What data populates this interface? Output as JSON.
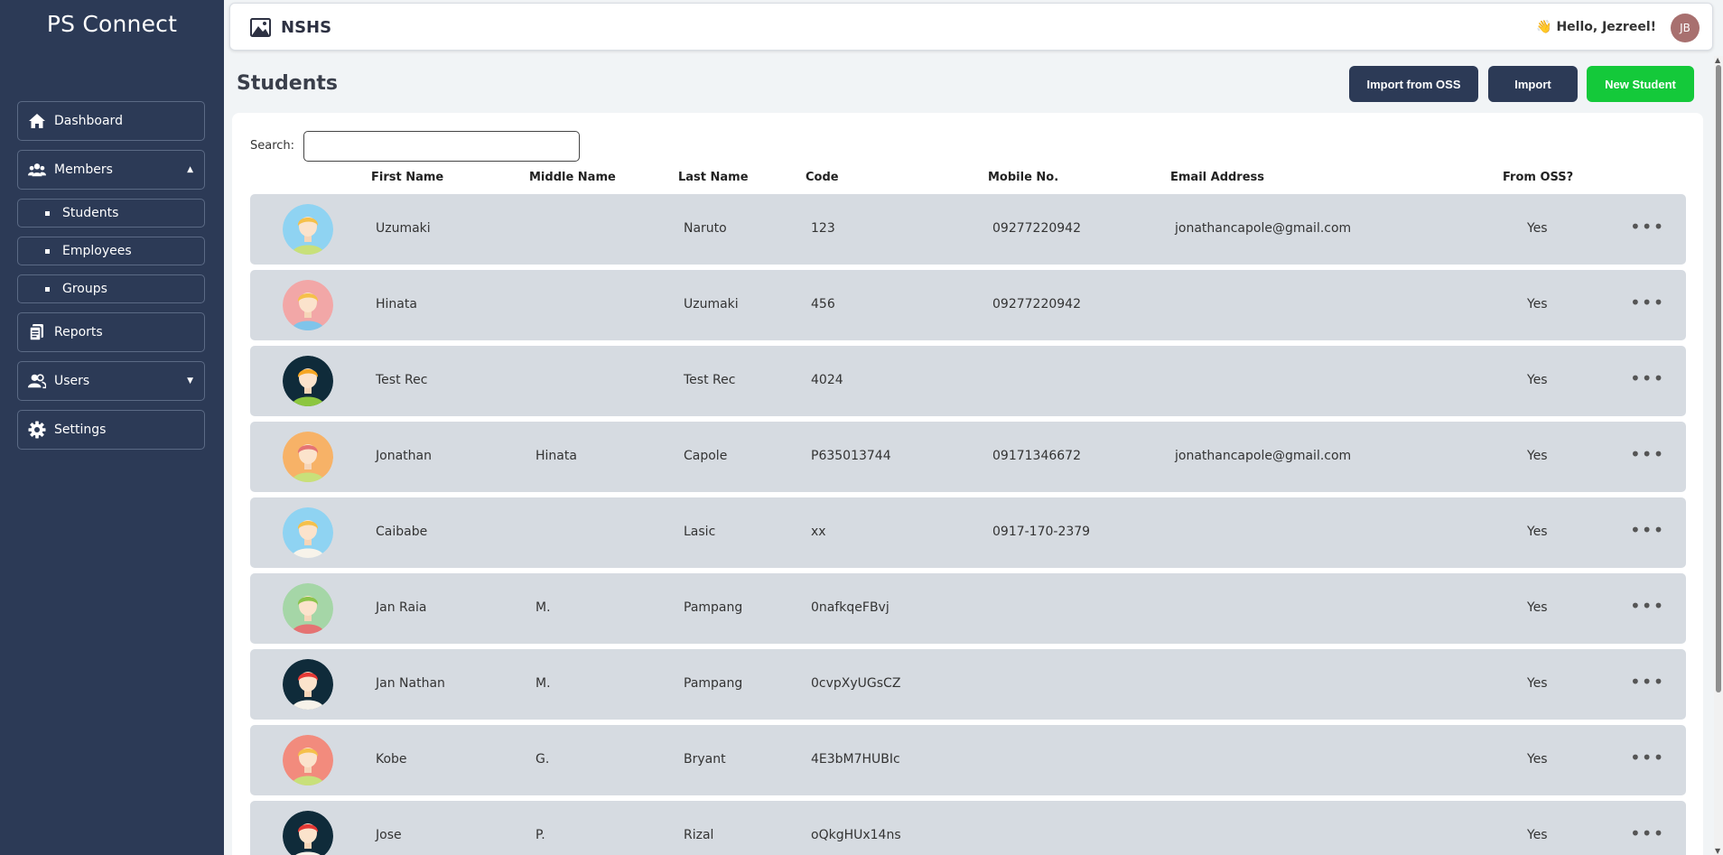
{
  "sidebar": {
    "brand": "PS Connect",
    "items": [
      {
        "label": "Dashboard"
      },
      {
        "label": "Members"
      },
      {
        "label": "Students"
      },
      {
        "label": "Employees"
      },
      {
        "label": "Groups"
      },
      {
        "label": "Reports"
      },
      {
        "label": "Users"
      },
      {
        "label": "Settings"
      }
    ]
  },
  "topbar": {
    "title": "NSHS",
    "greeting": "👋 Hello, Jezreel!",
    "avatar_initials": "JB"
  },
  "page": {
    "title": "Students",
    "buttons": {
      "import_oss": "Import from OSS",
      "import": "Import",
      "new_student": "New Student"
    }
  },
  "search": {
    "label": "Search:",
    "value": "",
    "placeholder": ""
  },
  "table": {
    "headers": {
      "first_name": "First Name",
      "middle_name": "Middle Name",
      "last_name": "Last Name",
      "code": "Code",
      "mobile": "Mobile No.",
      "email": "Email Address",
      "from_oss": "From OSS?"
    },
    "rows": [
      {
        "first": "Uzumaki",
        "middle": "",
        "last": "Naruto",
        "code": "123",
        "mobile": "09277220942",
        "email": "jonathancapole@gmail.com",
        "oss": "Yes",
        "avatar_bg": "#8fd3f2",
        "hair": "#f5c04a",
        "shirt": "#c8e07a"
      },
      {
        "first": "Hinata",
        "middle": "",
        "last": "Uzumaki",
        "code": "456",
        "mobile": "09277220942",
        "email": "",
        "oss": "Yes",
        "avatar_bg": "#f2a7a7",
        "hair": "#f5c04a",
        "shirt": "#7fc4ea"
      },
      {
        "first": "Test Rec",
        "middle": "",
        "last": "Test Rec",
        "code": "4024",
        "mobile": "",
        "email": "",
        "oss": "Yes",
        "avatar_bg": "#0f2b3a",
        "hair": "#f5a623",
        "shirt": "#8cc63f"
      },
      {
        "first": "Jonathan",
        "middle": "Hinata",
        "last": "Capole",
        "code": "P635013744",
        "mobile": "09171346672",
        "email": "jonathancapole@gmail.com",
        "oss": "Yes",
        "avatar_bg": "#f7b267",
        "hair": "#e57373",
        "shirt": "#c8e07a"
      },
      {
        "first": "Caibabe",
        "middle": "",
        "last": "Lasic",
        "code": "xx",
        "mobile": "0917-170-2379",
        "email": "",
        "oss": "Yes",
        "avatar_bg": "#8fd3f2",
        "hair": "#f5c04a",
        "shirt": "#f7f3ea"
      },
      {
        "first": "Jan Raia",
        "middle": "M.",
        "last": "Pampang",
        "code": "0nafkqeFBvj",
        "mobile": "",
        "email": "",
        "oss": "Yes",
        "avatar_bg": "#a5d6a7",
        "hair": "#8bc34a",
        "shirt": "#e57373"
      },
      {
        "first": "Jan Nathan",
        "middle": "M.",
        "last": "Pampang",
        "code": "0cvpXyUGsCZ",
        "mobile": "",
        "email": "",
        "oss": "Yes",
        "avatar_bg": "#0f2b3a",
        "hair": "#e53935",
        "shirt": "#f7f3ea"
      },
      {
        "first": "Kobe",
        "middle": "G.",
        "last": "Bryant",
        "code": "4E3bM7HUBIc",
        "mobile": "",
        "email": "",
        "oss": "Yes",
        "avatar_bg": "#f28b7d",
        "hair": "#f5c04a",
        "shirt": "#c8e07a"
      },
      {
        "first": "Jose",
        "middle": "P.",
        "last": "Rizal",
        "code": "oQkgHUx14ns",
        "mobile": "",
        "email": "",
        "oss": "Yes",
        "avatar_bg": "#0f2b3a",
        "hair": "#e53935",
        "shirt": "#f7f3ea"
      }
    ]
  },
  "colors": {
    "sidebar_bg": "#2c3a56",
    "accent_green": "#14c93a",
    "row_bg": "#d6dbe1"
  }
}
